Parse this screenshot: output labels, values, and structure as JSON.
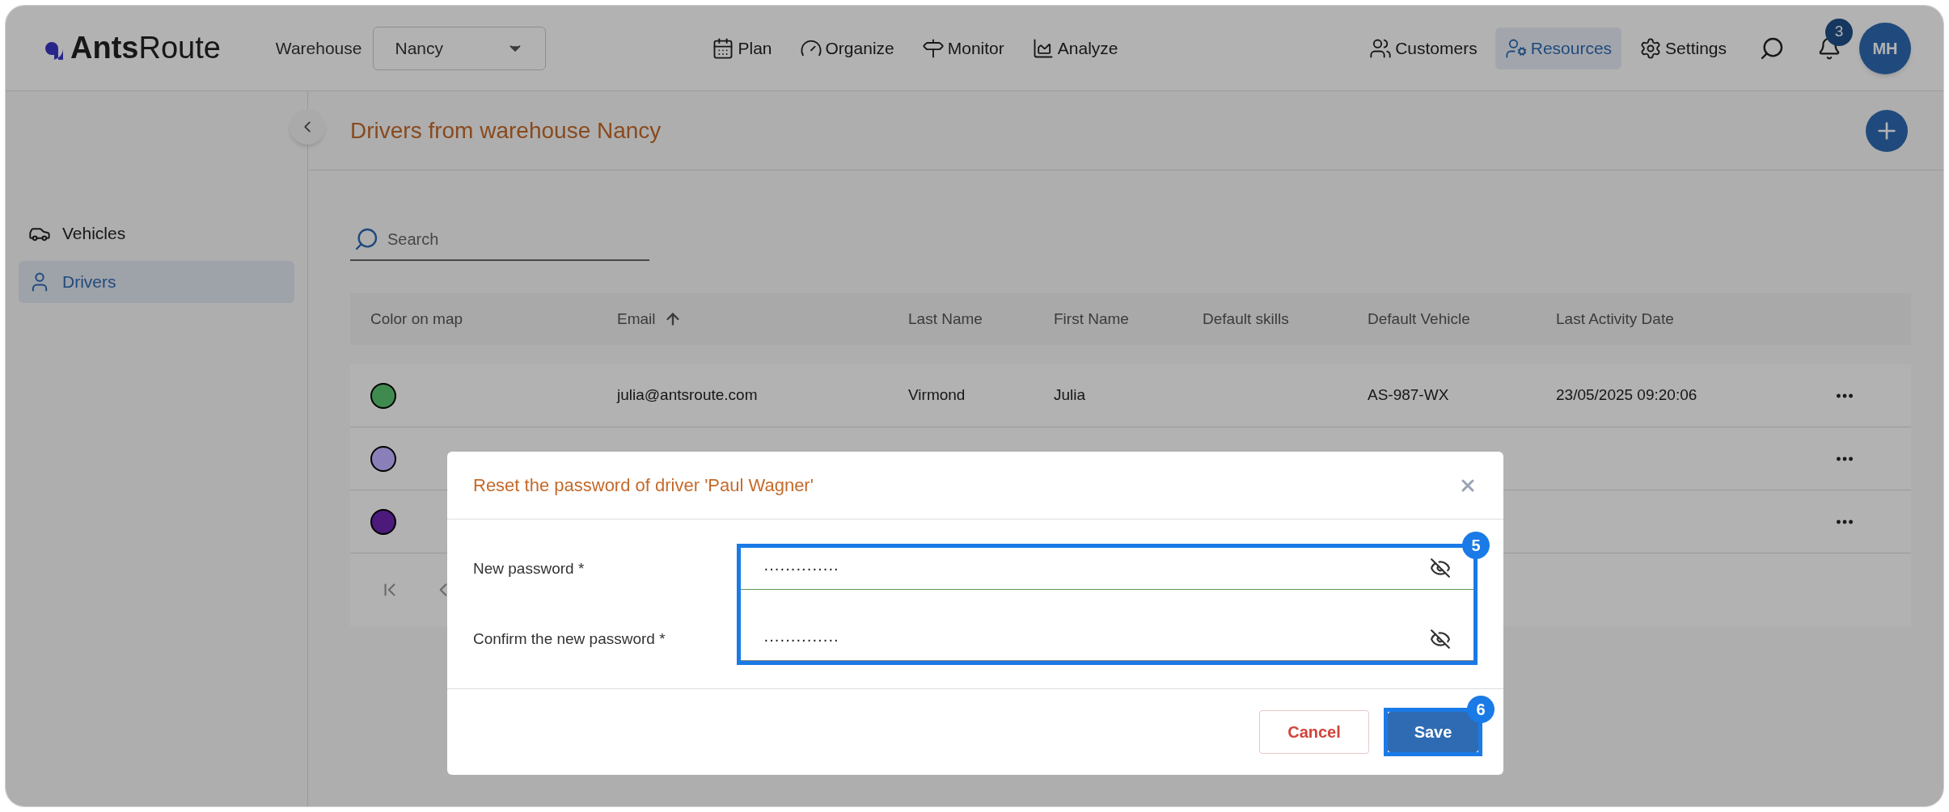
{
  "header": {
    "logo_bold": "Ants",
    "logo_light": "Route",
    "warehouse_label": "Warehouse",
    "warehouse_value": "Nancy",
    "nav": [
      {
        "label": "Plan"
      },
      {
        "label": "Organize"
      },
      {
        "label": "Monitor"
      },
      {
        "label": "Analyze"
      }
    ],
    "right_nav": [
      {
        "label": "Customers",
        "selected": false
      },
      {
        "label": "Resources",
        "selected": true
      },
      {
        "label": "Settings",
        "selected": false
      }
    ],
    "notifications": "3",
    "avatar": "MH"
  },
  "sidebar": {
    "items": [
      {
        "label": "Vehicles",
        "selected": false
      },
      {
        "label": "Drivers",
        "selected": true
      }
    ]
  },
  "page": {
    "title": "Drivers from warehouse Nancy"
  },
  "search": {
    "placeholder": "Search"
  },
  "table": {
    "columns": [
      {
        "label": "Color on map",
        "sorted": false
      },
      {
        "label": "Email",
        "sorted": true
      },
      {
        "label": "Last Name",
        "sorted": false
      },
      {
        "label": "First Name",
        "sorted": false
      },
      {
        "label": "Default skills",
        "sorted": false
      },
      {
        "label": "Default Vehicle",
        "sorted": false
      },
      {
        "label": "Last Activity Date",
        "sorted": false
      }
    ],
    "rows": [
      {
        "color": "#3f8a4f",
        "email": "julia@antsroute.com",
        "last_name": "Virmond",
        "first_name": "Julia",
        "default_vehicle": "AS-987-WX",
        "last_activity_date": "23/05/2025 09:20:06"
      },
      {
        "color": "#8a7fb8"
      },
      {
        "color": "#4b1a7a"
      }
    ]
  },
  "dialog": {
    "title": "Reset the password of driver 'Paul Wagner'",
    "callout": "5",
    "fields": [
      {
        "label": "New password *",
        "value": "··············",
        "focused": true
      },
      {
        "label": "Confirm the new password *",
        "value": "··············",
        "focused": false
      }
    ],
    "buttons": [
      {
        "label": "Cancel",
        "kind": "secondary"
      },
      {
        "label": "Save",
        "kind": "primary",
        "callout": "6"
      }
    ]
  }
}
